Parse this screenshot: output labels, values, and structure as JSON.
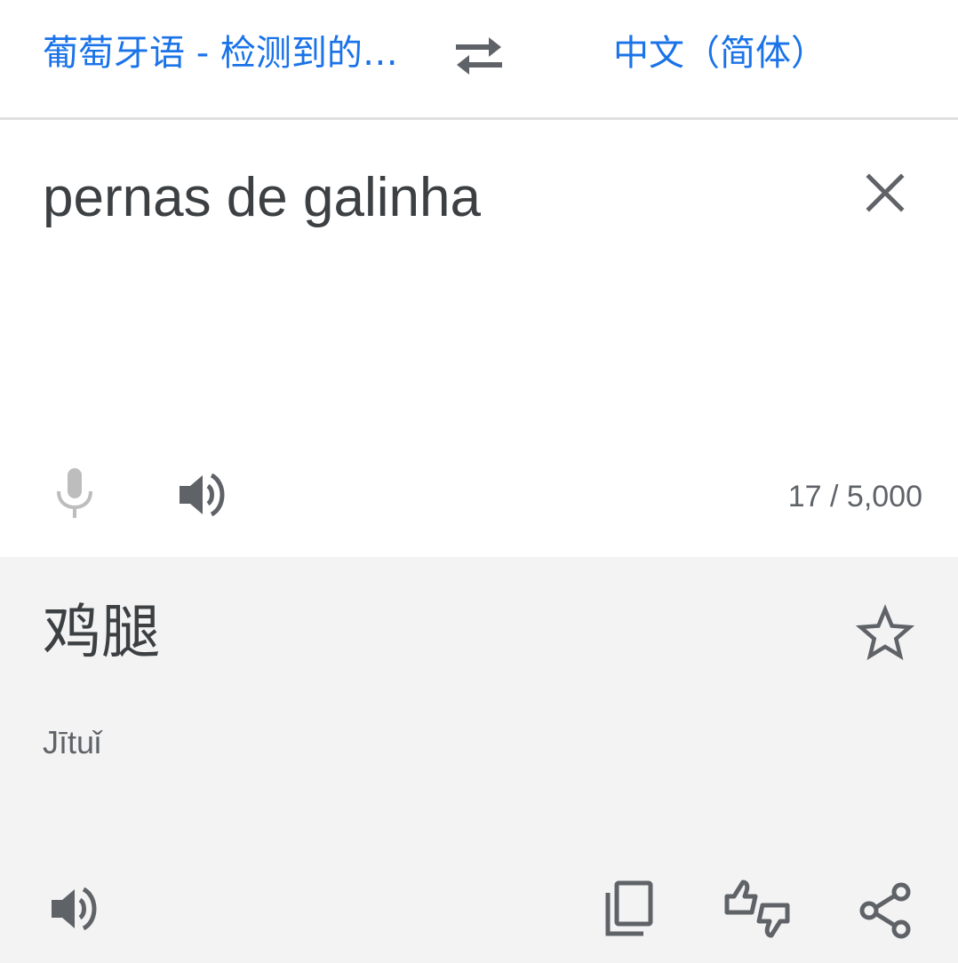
{
  "colors": {
    "accent": "#1a73e8",
    "text_primary": "#3c4043",
    "icon": "#5f6368",
    "icon_disabled": "#bdbdbd",
    "output_bg": "#f3f3f3",
    "divider": "#e0e0e0"
  },
  "language_bar": {
    "source_language": "葡萄牙语 - 检测到的…",
    "target_language": "中文（简体）",
    "swap_icon": "swap-arrows-icon"
  },
  "input": {
    "text": "pernas de galinha",
    "clear_icon": "close-icon",
    "mic_icon": "microphone-icon",
    "mic_enabled": false,
    "speak_icon": "speaker-icon",
    "char_count": "17 / 5,000"
  },
  "output": {
    "translation": "鸡腿",
    "romanization": "Jītuǐ",
    "star_icon": "star-outline-icon",
    "speak_icon": "speaker-icon",
    "copy_icon": "copy-icon",
    "feedback_icon": "thumbs-feedback-icon",
    "share_icon": "share-icon"
  }
}
